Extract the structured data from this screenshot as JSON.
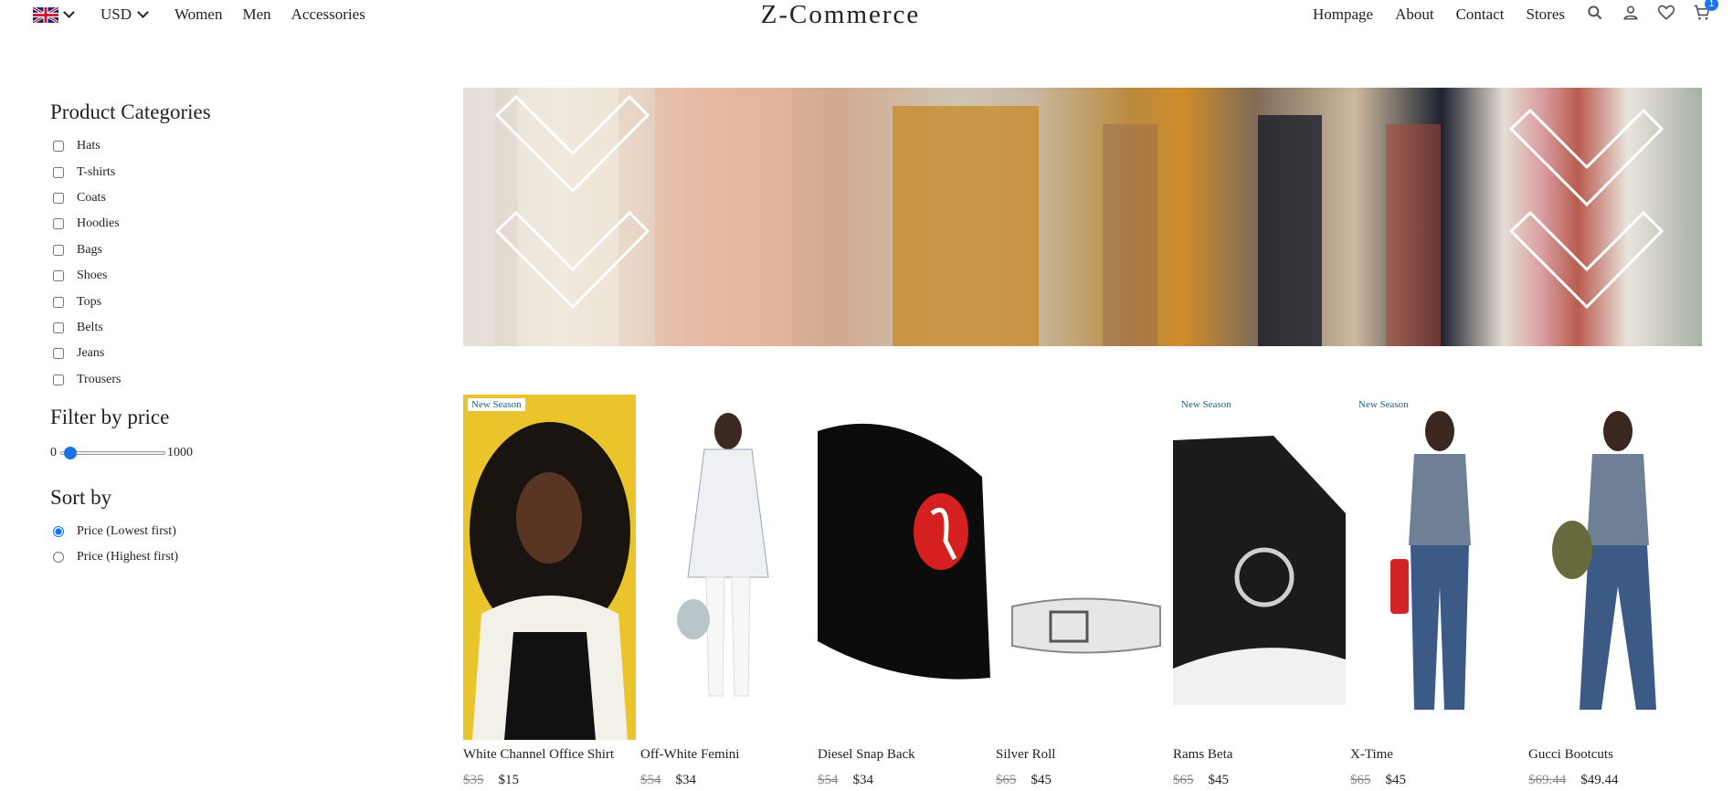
{
  "header": {
    "currency": "USD",
    "nav_left": [
      "Women",
      "Men",
      "Accessories"
    ],
    "logo": "Z-Commerce",
    "nav_right": [
      "Hompage",
      "About",
      "Contact",
      "Stores"
    ],
    "cart_count": "1",
    "icons": [
      "flag-uk-icon",
      "chevron-down-icon",
      "search-icon",
      "user-icon",
      "heart-icon",
      "cart-icon"
    ]
  },
  "sidebar": {
    "categories_title": "Product Categories",
    "categories": [
      "Hats",
      "T-shirts",
      "Coats",
      "Hoodies",
      "Bags",
      "Shoes",
      "Tops",
      "Belts",
      "Jeans",
      "Trousers"
    ],
    "price_title": "Filter by price",
    "price_min": "0",
    "price_max": "1000",
    "price_slider_value": 0.05,
    "sort_title": "Sort by",
    "sort_options": [
      "Price (Lowest first)",
      "Price (Highest first)"
    ],
    "sort_selected": 0
  },
  "products": [
    {
      "name": "White Channel Office Shirt",
      "old_price": "$35",
      "price": "$15",
      "tag": "New Season"
    },
    {
      "name": "Off-White Femini",
      "old_price": "$54",
      "price": "$34",
      "tag": ""
    },
    {
      "name": "Diesel Snap Back",
      "old_price": "$54",
      "price": "$34",
      "tag": ""
    },
    {
      "name": "Silver Roll",
      "old_price": "$65",
      "price": "$45",
      "tag": ""
    },
    {
      "name": "Rams Beta",
      "old_price": "$65",
      "price": "$45",
      "tag": "New Season"
    },
    {
      "name": "X-Time",
      "old_price": "$65",
      "price": "$45",
      "tag": "New Season"
    },
    {
      "name": "Gucci Bootcuts",
      "old_price": "$69.44",
      "price": "$49.44",
      "tag": ""
    }
  ],
  "colors": {
    "accent": "#1a73e8",
    "tag_text": "#1c5f8a"
  }
}
